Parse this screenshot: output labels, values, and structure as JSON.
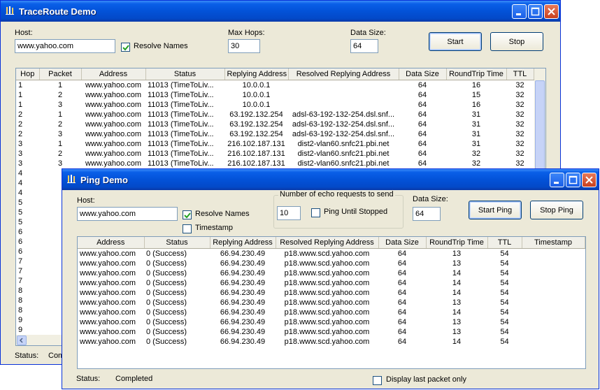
{
  "traceroute": {
    "title": "TraceRoute Demo",
    "host_label": "Host:",
    "host_value": "www.yahoo.com",
    "resolve_label": "Resolve Names",
    "resolve_checked": true,
    "maxhops_label": "Max Hops:",
    "maxhops_value": "30",
    "datasize_label": "Data Size:",
    "datasize_value": "64",
    "start_label": "Start",
    "stop_label": "Stop",
    "columns": [
      "Hop",
      "Packet",
      "Address",
      "Status",
      "Replying Address",
      "Resolved Replying Address",
      "Data Size",
      "RoundTrip Time",
      "TTL"
    ],
    "rows": [
      [
        "1",
        "1",
        "www.yahoo.com",
        "11013 (TimeToLiv...",
        "10.0.0.1",
        "",
        "64",
        "16",
        "32"
      ],
      [
        "1",
        "2",
        "www.yahoo.com",
        "11013 (TimeToLiv...",
        "10.0.0.1",
        "",
        "64",
        "15",
        "32"
      ],
      [
        "1",
        "3",
        "www.yahoo.com",
        "11013 (TimeToLiv...",
        "10.0.0.1",
        "",
        "64",
        "16",
        "32"
      ],
      [
        "2",
        "1",
        "www.yahoo.com",
        "11013 (TimeToLiv...",
        "63.192.132.254",
        "adsl-63-192-132-254.dsl.snf...",
        "64",
        "31",
        "32"
      ],
      [
        "2",
        "2",
        "www.yahoo.com",
        "11013 (TimeToLiv...",
        "63.192.132.254",
        "adsl-63-192-132-254.dsl.snf...",
        "64",
        "31",
        "32"
      ],
      [
        "2",
        "3",
        "www.yahoo.com",
        "11013 (TimeToLiv...",
        "63.192.132.254",
        "adsl-63-192-132-254.dsl.snf...",
        "64",
        "31",
        "32"
      ],
      [
        "3",
        "1",
        "www.yahoo.com",
        "11013 (TimeToLiv...",
        "216.102.187.131",
        "dist2-vlan60.snfc21.pbi.net",
        "64",
        "31",
        "32"
      ],
      [
        "3",
        "2",
        "www.yahoo.com",
        "11013 (TimeToLiv...",
        "216.102.187.131",
        "dist2-vlan60.snfc21.pbi.net",
        "64",
        "32",
        "32"
      ],
      [
        "3",
        "3",
        "www.yahoo.com",
        "11013 (TimeToLiv...",
        "216.102.187.131",
        "dist2-vlan60.snfc21.pbi.net",
        "64",
        "32",
        "32"
      ],
      [
        "4",
        "",
        "",
        "",
        "",
        "",
        "",
        "",
        ""
      ],
      [
        "4",
        "",
        "",
        "",
        "",
        "",
        "",
        "",
        ""
      ],
      [
        "4",
        "",
        "",
        "",
        "",
        "",
        "",
        "",
        ""
      ],
      [
        "5",
        "",
        "",
        "",
        "",
        "",
        "",
        "",
        ""
      ],
      [
        "5",
        "",
        "",
        "",
        "",
        "",
        "",
        "",
        ""
      ],
      [
        "5",
        "",
        "",
        "",
        "",
        "",
        "",
        "",
        ""
      ],
      [
        "6",
        "",
        "",
        "",
        "",
        "",
        "",
        "",
        ""
      ],
      [
        "6",
        "",
        "",
        "",
        "",
        "",
        "",
        "",
        ""
      ],
      [
        "6",
        "",
        "",
        "",
        "",
        "",
        "",
        "",
        ""
      ],
      [
        "7",
        "",
        "",
        "",
        "",
        "",
        "",
        "",
        ""
      ],
      [
        "7",
        "",
        "",
        "",
        "",
        "",
        "",
        "",
        ""
      ],
      [
        "7",
        "",
        "",
        "",
        "",
        "",
        "",
        "",
        ""
      ],
      [
        "8",
        "",
        "",
        "",
        "",
        "",
        "",
        "",
        ""
      ],
      [
        "8",
        "",
        "",
        "",
        "",
        "",
        "",
        "",
        ""
      ],
      [
        "8",
        "",
        "",
        "",
        "",
        "",
        "",
        "",
        ""
      ],
      [
        "9",
        "",
        "",
        "",
        "",
        "",
        "",
        "",
        ""
      ],
      [
        "9",
        "",
        "",
        "",
        "",
        "",
        "",
        "",
        ""
      ]
    ],
    "status_label": "Status:",
    "status_value": "Com"
  },
  "ping": {
    "title": "Ping Demo",
    "host_label": "Host:",
    "host_value": "www.yahoo.com",
    "resolve_label": "Resolve Names",
    "resolve_checked": true,
    "timestamp_label": "Timestamp",
    "timestamp_checked": false,
    "echo_group_label": "Number of echo requests to send",
    "echo_value": "10",
    "until_stopped_label": "Ping Until Stopped",
    "until_stopped_checked": false,
    "datasize_label": "Data Size:",
    "datasize_value": "64",
    "start_label": "Start Ping",
    "stop_label": "Stop Ping",
    "columns": [
      "Address",
      "Status",
      "Replying Address",
      "Resolved Replying Address",
      "Data Size",
      "RoundTrip Time",
      "TTL",
      "Timestamp"
    ],
    "rows": [
      [
        "www.yahoo.com",
        "0 (Success)",
        "66.94.230.49",
        "p18.www.scd.yahoo.com",
        "64",
        "13",
        "54",
        ""
      ],
      [
        "www.yahoo.com",
        "0 (Success)",
        "66.94.230.49",
        "p18.www.scd.yahoo.com",
        "64",
        "13",
        "54",
        ""
      ],
      [
        "www.yahoo.com",
        "0 (Success)",
        "66.94.230.49",
        "p18.www.scd.yahoo.com",
        "64",
        "14",
        "54",
        ""
      ],
      [
        "www.yahoo.com",
        "0 (Success)",
        "66.94.230.49",
        "p18.www.scd.yahoo.com",
        "64",
        "14",
        "54",
        ""
      ],
      [
        "www.yahoo.com",
        "0 (Success)",
        "66.94.230.49",
        "p18.www.scd.yahoo.com",
        "64",
        "14",
        "54",
        ""
      ],
      [
        "www.yahoo.com",
        "0 (Success)",
        "66.94.230.49",
        "p18.www.scd.yahoo.com",
        "64",
        "13",
        "54",
        ""
      ],
      [
        "www.yahoo.com",
        "0 (Success)",
        "66.94.230.49",
        "p18.www.scd.yahoo.com",
        "64",
        "14",
        "54",
        ""
      ],
      [
        "www.yahoo.com",
        "0 (Success)",
        "66.94.230.49",
        "p18.www.scd.yahoo.com",
        "64",
        "13",
        "54",
        ""
      ],
      [
        "www.yahoo.com",
        "0 (Success)",
        "66.94.230.49",
        "p18.www.scd.yahoo.com",
        "64",
        "13",
        "54",
        ""
      ],
      [
        "www.yahoo.com",
        "0 (Success)",
        "66.94.230.49",
        "p18.www.scd.yahoo.com",
        "64",
        "14",
        "54",
        ""
      ]
    ],
    "status_label": "Status:",
    "status_value": "Completed",
    "display_last_label": "Display last packet only",
    "display_last_checked": false
  }
}
